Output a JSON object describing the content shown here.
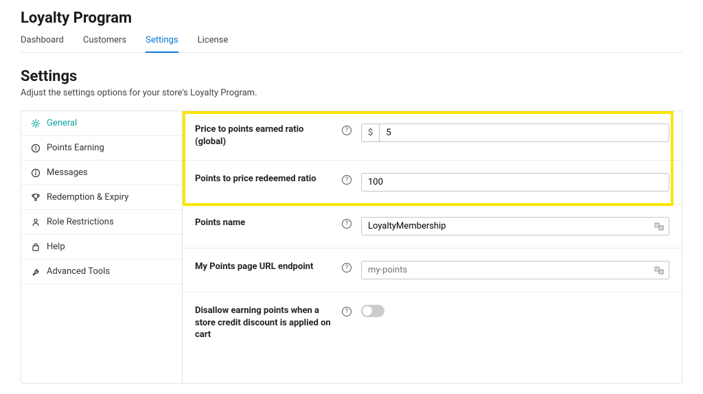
{
  "header": {
    "title": "Loyalty Program"
  },
  "tabs": {
    "items": [
      "Dashboard",
      "Customers",
      "Settings",
      "License"
    ],
    "active_index": 2
  },
  "section": {
    "title": "Settings",
    "subtitle": "Adjust the settings options for your store's Loyalty Program."
  },
  "sidebar": {
    "items": [
      {
        "label": "General",
        "icon": "gear-icon",
        "active": true
      },
      {
        "label": "Points Earning",
        "icon": "coin-icon",
        "active": false
      },
      {
        "label": "Messages",
        "icon": "info-icon",
        "active": false
      },
      {
        "label": "Redemption & Expiry",
        "icon": "trophy-icon",
        "active": false
      },
      {
        "label": "Role Restrictions",
        "icon": "person-icon",
        "active": false
      },
      {
        "label": "Help",
        "icon": "bag-icon",
        "active": false
      },
      {
        "label": "Advanced Tools",
        "icon": "wrench-icon",
        "active": false
      }
    ]
  },
  "fields": {
    "price_to_points": {
      "label": "Price to points earned ratio (global)",
      "currency_symbol": "$",
      "value": "5"
    },
    "points_to_price": {
      "label": "Points to price redeemed ratio",
      "value": "100"
    },
    "points_name": {
      "label": "Points name",
      "value": "LoyaltyMembership"
    },
    "url_endpoint": {
      "label": "My Points page URL endpoint",
      "placeholder": "my-points",
      "value": ""
    },
    "disallow_earning": {
      "label": "Disallow earning points when a store credit discount is applied on cart",
      "enabled": false
    }
  }
}
